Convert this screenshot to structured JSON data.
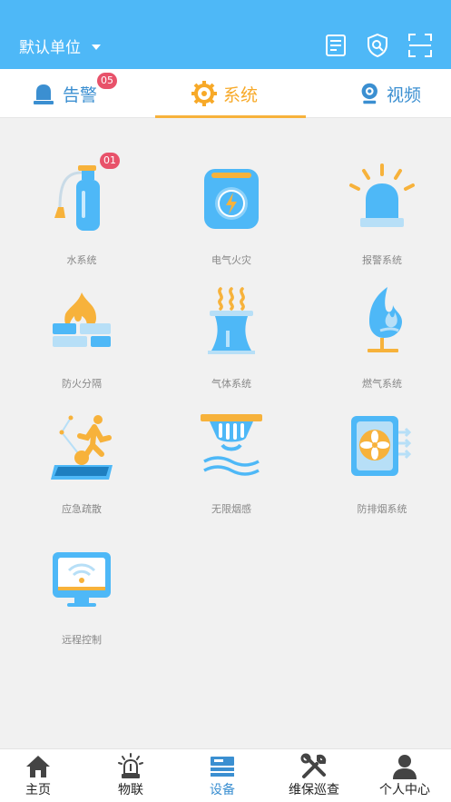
{
  "header": {
    "unit_label": "默认单位"
  },
  "tabs": [
    {
      "label": "告警",
      "badge": "05"
    },
    {
      "label": "系统"
    },
    {
      "label": "视频"
    }
  ],
  "grid": [
    {
      "label": "水系统",
      "badge": "01"
    },
    {
      "label": "电气火灾"
    },
    {
      "label": "报警系统"
    },
    {
      "label": "防火分隔"
    },
    {
      "label": "气体系统"
    },
    {
      "label": "燃气系统"
    },
    {
      "label": "应急疏散"
    },
    {
      "label": "无限烟感"
    },
    {
      "label": "防排烟系统"
    },
    {
      "label": "远程控制"
    }
  ],
  "bottom_nav": [
    {
      "label": "主页"
    },
    {
      "label": "物联"
    },
    {
      "label": "设备"
    },
    {
      "label": "维保巡查"
    },
    {
      "label": "个人中心"
    }
  ],
  "colors": {
    "primary": "#4eb8f7",
    "accent": "#f7b23b",
    "badge": "#e8526a",
    "active_tab": "#f7a928",
    "inactive_tab": "#3b8fd1"
  }
}
